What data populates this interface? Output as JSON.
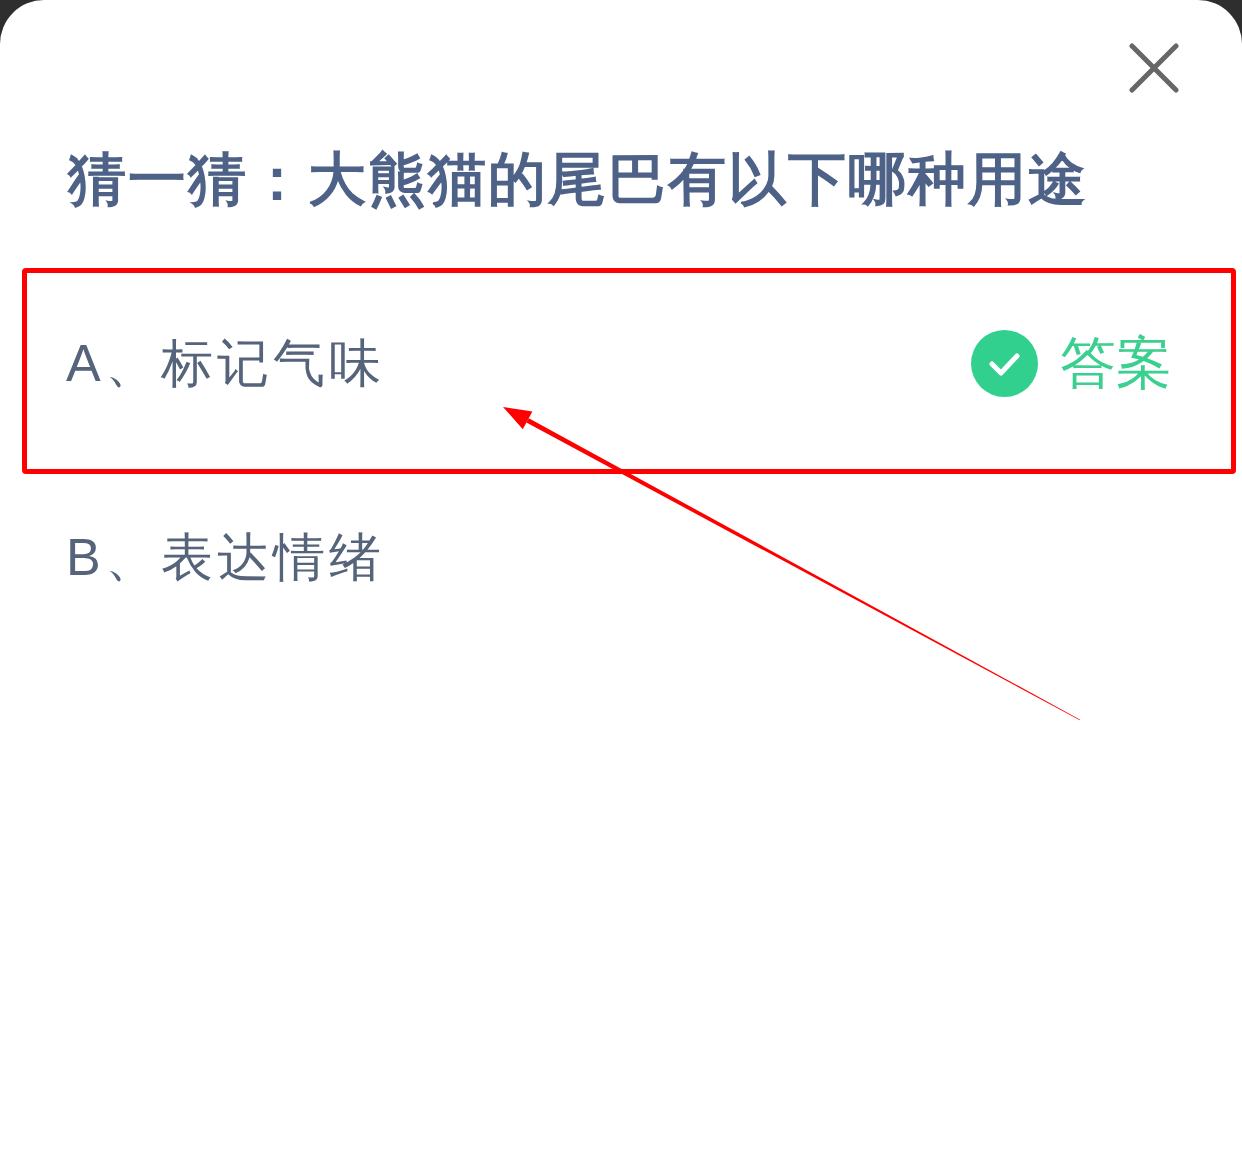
{
  "title": "猜一猜：大熊猫的尾巴有以下哪种用途",
  "options": [
    {
      "label": "A、标记气味",
      "correct": true,
      "answer_tag": "答案",
      "highlighted": true
    },
    {
      "label": "B、表达情绪",
      "correct": false,
      "highlighted": false
    }
  ]
}
